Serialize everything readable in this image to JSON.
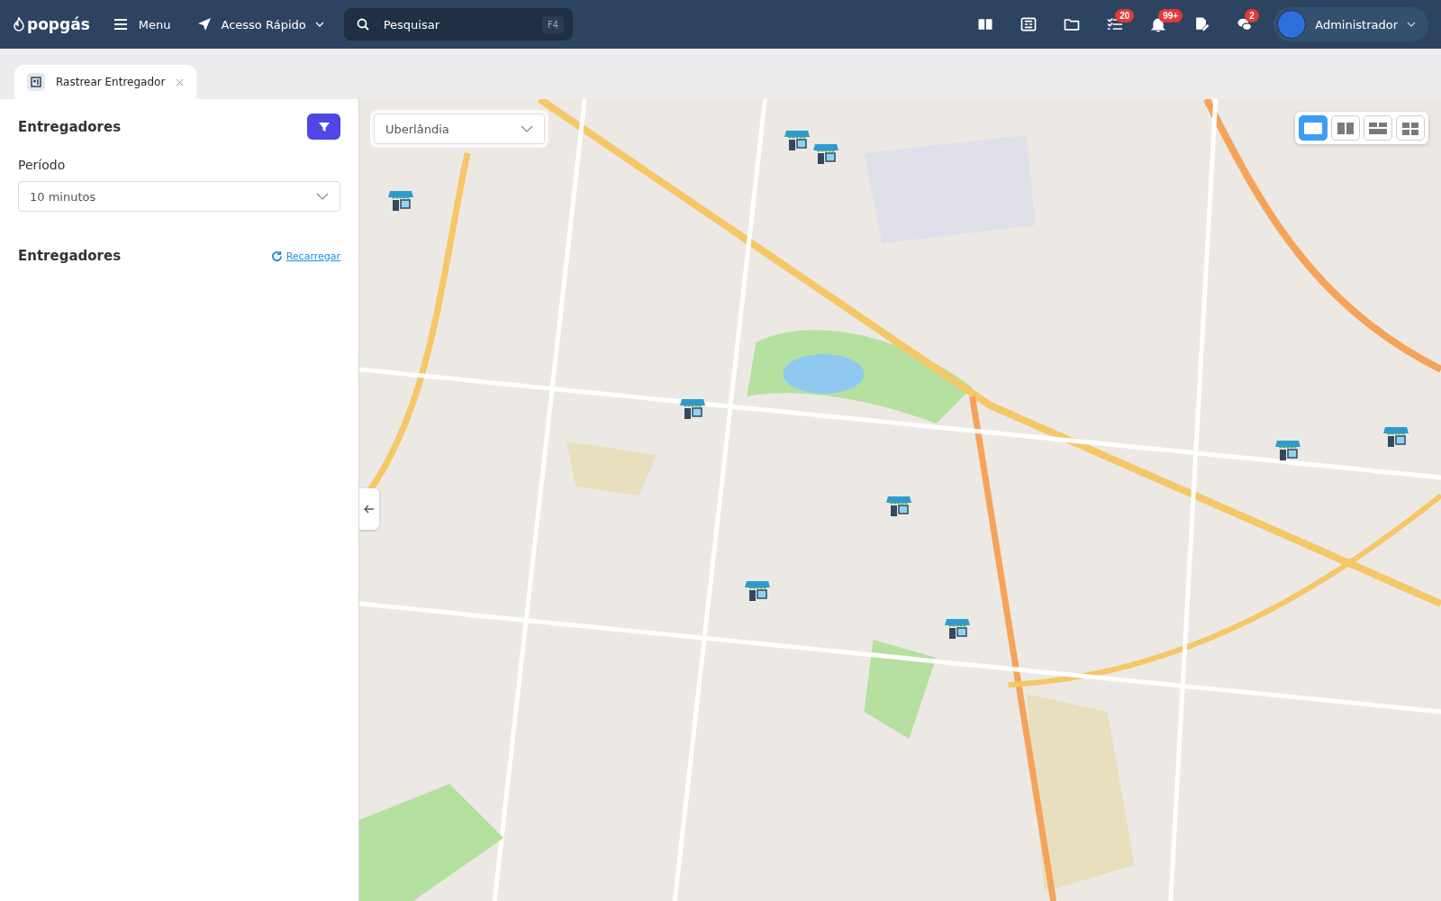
{
  "header": {
    "logo": "popgás",
    "menu_label": "Menu",
    "quick_access_label": "Acesso Rápido",
    "search": {
      "placeholder": "Pesquisar",
      "shortcut": "F4"
    },
    "icons": [
      {
        "kind": "book"
      },
      {
        "kind": "news"
      },
      {
        "kind": "folder"
      },
      {
        "kind": "tasks",
        "badge": "20"
      },
      {
        "kind": "bell",
        "badge": "99+"
      },
      {
        "kind": "edit"
      },
      {
        "kind": "chat",
        "badge": "2"
      }
    ],
    "user": {
      "name": "Administrador"
    }
  },
  "tabs": [
    {
      "label": "Rastrear Entregador",
      "selected": true
    }
  ],
  "sidebar": {
    "title": "Entregadores",
    "period_label": "Período",
    "period_value": "10 minutos",
    "list_title": "Entregadores",
    "reload_link": "Recarregar"
  },
  "map": {
    "city": "Uberlândia",
    "layout_options": [
      {
        "kind": "single",
        "selected": true
      },
      {
        "kind": "two-columns",
        "selected": false
      },
      {
        "kind": "two-rows",
        "selected": false
      },
      {
        "kind": "grid",
        "selected": false
      }
    ]
  }
}
